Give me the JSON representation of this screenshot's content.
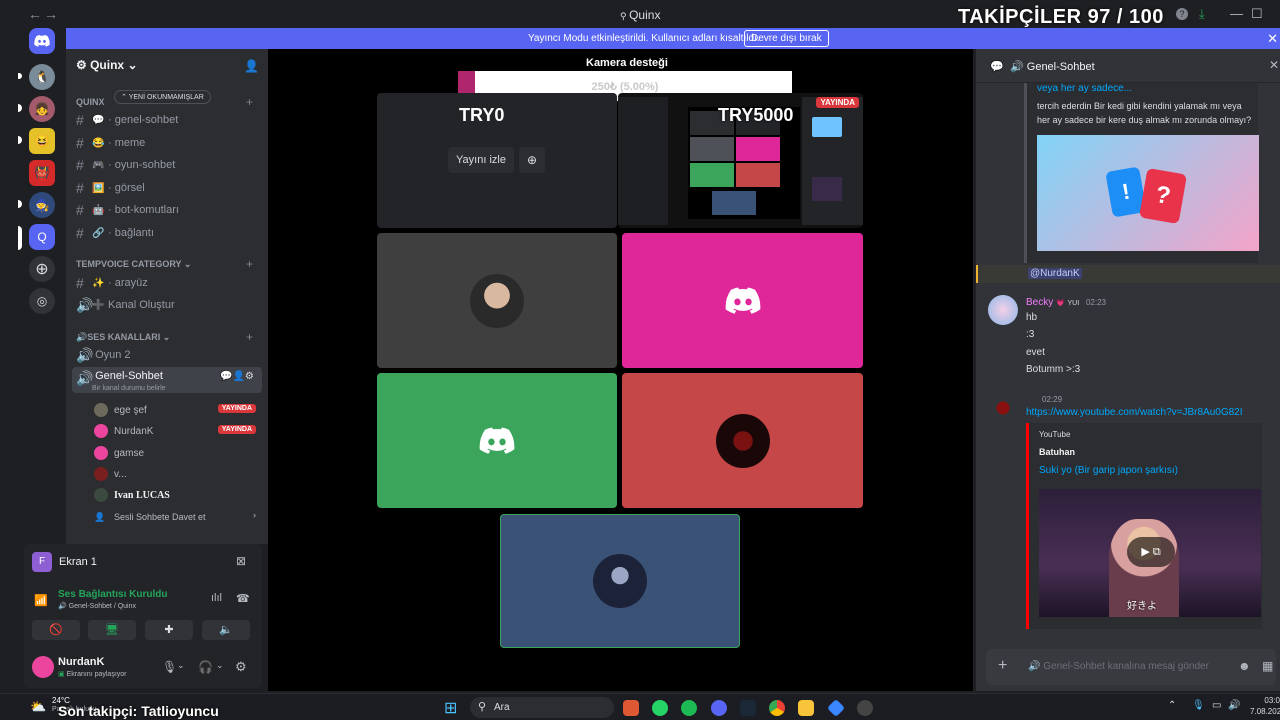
{
  "window": {
    "title": "Quinx",
    "back": "←",
    "forward": "→",
    "help": "?",
    "minimize": "—",
    "maximize": "☐",
    "close": "✕"
  },
  "overlay": {
    "followers": "TAKİPÇİLER 97 / 100",
    "last_follower": "Son takipçi: Tatlioyuncu"
  },
  "banner": {
    "text": "Yayıncı Modu etkinleştirildi. Kullanıcı adları kısaltıldı.",
    "button": "Devre dışı bırak"
  },
  "guild": {
    "name": "Quinx",
    "unread_chip": "YENİ OKUNMAMIŞLAR",
    "category_quinx": "Quinx",
    "text_channels": [
      {
        "emoji": "💬",
        "name": "genel-sohbet"
      },
      {
        "emoji": "😂",
        "name": "meme"
      },
      {
        "emoji": "🎮",
        "name": "oyun-sohbet"
      },
      {
        "emoji": "🖼️",
        "name": "görsel"
      },
      {
        "emoji": "🤖",
        "name": "bot-komutları"
      },
      {
        "emoji": "🔗",
        "name": "bağlantı"
      }
    ],
    "tempvoice_category": "TEMPVOICE CATEGORY",
    "tempvoice_channels": [
      {
        "emoji": "✨",
        "name": "arayüz"
      },
      {
        "emoji": "➕",
        "name": "Kanal Oluştur"
      }
    ],
    "voice_category": "🔊SES KANALLARI",
    "voice_channels": [
      {
        "name": "Oyun 2"
      },
      {
        "name": "Genel-Sohbet",
        "status": "Bir kanal durumu belirle"
      }
    ],
    "members": [
      {
        "name": "ege şef",
        "live": "YAYINDA",
        "color": "#6d6a5c"
      },
      {
        "name": "NurdanK",
        "live": "YAYINDA",
        "color": "#eb459e"
      },
      {
        "name": "gamse",
        "live": "",
        "color": "#eb459e"
      },
      {
        "name": "v...",
        "live": "",
        "color": "#7a1f1f"
      },
      {
        "name": "Ivan LUCAS",
        "live": "",
        "color": "#3b4a3e"
      }
    ],
    "invite": "Sesli Sohbete Davet et"
  },
  "screen_panel": {
    "label": "Ekran 1"
  },
  "voice_panel": {
    "status": "Ses Bağlantısı Kuruldu",
    "channel": "Genel-Sohbet / Quinx"
  },
  "user_panel": {
    "name": "NurdanK",
    "status": "Ekranını paylaşıyor"
  },
  "stage": {
    "camera_label": "Kamera desteği",
    "goal_text": "250₺ (5.00%)",
    "goal_progress": 0.05,
    "tile1_name": "TRY0",
    "tile2_name": "TRY5000",
    "watch_button": "Yayını izle",
    "live_badge": "YAYINDA"
  },
  "chat": {
    "channel": "Genel-Sohbet",
    "embed_title": "veya her ay sadece...",
    "embed_desc": "tercih ederdin Bir kedi gibi kendini yalamak mı veya her ay sadece bir kere duş almak mı zorunda olmayı?",
    "mention": "@NurdanK",
    "msg1": {
      "author": "Becky",
      "badge": "YUI",
      "time": "02:23",
      "lines": [
        "hb",
        ":3",
        "evet",
        "Botumm >:3"
      ]
    },
    "msg2": {
      "time": "02:29",
      "link": "https://www.youtube.com/watch?v=JBr8Au0G82I"
    },
    "yt": {
      "provider": "YouTube",
      "author": "Batuhan",
      "title": "Suki yo (Bir garip japon şarkısı)",
      "subtitle": "好きよ"
    },
    "input_placeholder": "Genel-Sohbet kanalına mesaj gönder"
  },
  "taskbar": {
    "temp": "24°C",
    "weather": "Parçalı bulutlu",
    "search": "Ara",
    "time": "03:0",
    "date": "7.08.202"
  },
  "colors": {
    "blurple": "#5865f2",
    "pink_tile": "#e0279a",
    "green_tile": "#3ba55c",
    "red_tile": "#c64747",
    "blue_tile": "#3b5277"
  }
}
